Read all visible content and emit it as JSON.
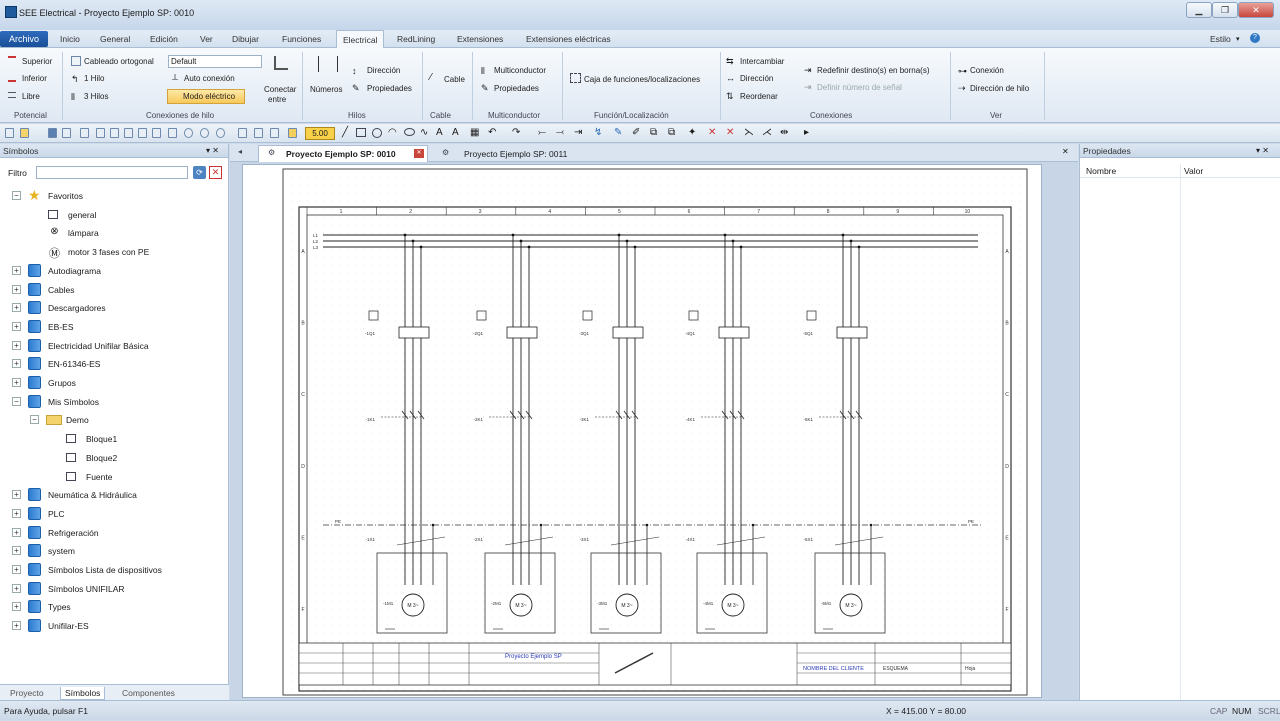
{
  "window": {
    "title": "SEE Electrical - Proyecto Ejemplo SP: 0010"
  },
  "menu": {
    "tabs": [
      "Archivo",
      "Inicio",
      "General",
      "Edición",
      "Ver",
      "Dibujar",
      "Funciones",
      "Electrical",
      "RedLining",
      "Extensiones",
      "Extensiones eléctricas"
    ],
    "style_label": "Estilo"
  },
  "ribbon": {
    "potencial": {
      "superior": "Superior",
      "inferior": "Inferior",
      "libre": "Libre",
      "group": "Potencial"
    },
    "conexiones_hilo": {
      "cableado": "Cableado ortogonal",
      "default": "Default",
      "one": "1 Hilo",
      "auto": "Auto conexión",
      "three": "3 Hilos",
      "modo": "Modo eléctrico",
      "conectar": "Conectar",
      "entre": "entre",
      "group": "Conexiones de hilo"
    },
    "hilos": {
      "numeros": "Números",
      "direccion": "Dirección",
      "propiedades": "Propiedades",
      "group": "Hilos"
    },
    "cable": {
      "cable": "Cable",
      "group": "Cable"
    },
    "multiconductor": {
      "multi": "Multiconductor",
      "propiedades": "Propiedades",
      "group": "Multiconductor"
    },
    "funcion": {
      "caja": "Caja de funciones/localizaciones",
      "group": "Función/Localización"
    },
    "conexiones": {
      "intercambiar": "Intercambiar",
      "direccion": "Dirección",
      "reordenar": "Reordenar",
      "redefinir": "Redefinir destino(s) en borna(s)",
      "definir": "Definir número de señal",
      "group": "Conexiones"
    },
    "ver": {
      "conexion": "Conexión",
      "direccion_hilo": "Dirección de hilo",
      "group": "Ver"
    }
  },
  "toolbar": {
    "zoom_value": "5.00"
  },
  "left_panel": {
    "title": "Símbolos",
    "filter_label": "Filtro",
    "tree": [
      {
        "label": "Favoritos",
        "level": 0,
        "expanded": true,
        "icon": "star-icon"
      },
      {
        "label": "general",
        "level": 1,
        "icon": "symbol-icon"
      },
      {
        "label": "lámpara",
        "level": 1,
        "icon": "lamp-icon"
      },
      {
        "label": "motor 3 fases con PE",
        "level": 1,
        "icon": "motor-icon"
      },
      {
        "label": "Autodiagrama",
        "level": 0,
        "icon": "book-icon"
      },
      {
        "label": "Cables",
        "level": 0,
        "icon": "book-icon"
      },
      {
        "label": "Descargadores",
        "level": 0,
        "icon": "book-icon"
      },
      {
        "label": "EB-ES",
        "level": 0,
        "icon": "book-icon"
      },
      {
        "label": "Electricidad Unifilar Básica",
        "level": 0,
        "icon": "book-icon"
      },
      {
        "label": "EN-61346-ES",
        "level": 0,
        "icon": "book-icon"
      },
      {
        "label": "Grupos",
        "level": 0,
        "icon": "book-icon"
      },
      {
        "label": "Mis Símbolos",
        "level": 0,
        "expanded": true,
        "icon": "book-icon"
      },
      {
        "label": "Demo",
        "level": 1,
        "expanded": true,
        "icon": "folder-icon"
      },
      {
        "label": "Bloque1",
        "level": 2,
        "icon": "symbol-icon"
      },
      {
        "label": "Bloque2",
        "level": 2,
        "icon": "symbol-icon"
      },
      {
        "label": "Fuente",
        "level": 2,
        "icon": "symbol-icon"
      },
      {
        "label": "Neumática & Hidráulica",
        "level": 0,
        "icon": "book-icon"
      },
      {
        "label": "PLC",
        "level": 0,
        "icon": "book-icon"
      },
      {
        "label": "Refrigeración",
        "level": 0,
        "icon": "book-icon"
      },
      {
        "label": "system",
        "level": 0,
        "icon": "book-icon"
      },
      {
        "label": "Símbolos Lista de dispositivos",
        "level": 0,
        "icon": "book-icon"
      },
      {
        "label": "Símbolos UNIFILAR",
        "level": 0,
        "icon": "book-icon"
      },
      {
        "label": "Types",
        "level": 0,
        "icon": "book-icon"
      },
      {
        "label": "Unifilar-ES",
        "level": 0,
        "icon": "book-icon"
      }
    ],
    "bottom_tabs": [
      "Proyecto",
      "Símbolos",
      "Componentes"
    ]
  },
  "document": {
    "tabs": [
      "Proyecto Ejemplo SP: 0010",
      "Proyecto Ejemplo SP: 0011"
    ]
  },
  "drawing": {
    "column_markers": [
      "1",
      "2",
      "3",
      "4",
      "5",
      "6",
      "7",
      "8",
      "9",
      "10"
    ],
    "row_markers": [
      "A",
      "B",
      "C",
      "D",
      "E",
      "F"
    ],
    "bus_labels": [
      "L1",
      "L2",
      "L3"
    ],
    "pe_label": "PE",
    "circuits": [
      {
        "q1": "-1Q1",
        "k1": "-1K1",
        "m": "-1M1",
        "x": "-1X1"
      },
      {
        "q1": "-2Q1",
        "k1": "-2K1",
        "m": "-2M1",
        "x": "-2X1"
      },
      {
        "q1": "-3Q1",
        "k1": "-3K1",
        "m": "-3M1",
        "x": "-3X1"
      },
      {
        "q1": "-4Q1",
        "k1": "-4K1",
        "m": "-4M1",
        "x": "-4X1"
      },
      {
        "q1": "-5Q1",
        "k1": "-5K1",
        "m": "-5M1",
        "x": "-5X1"
      }
    ],
    "motor_label": "M 3~",
    "title_block": {
      "project": "Proyecto Ejemplo SP",
      "client": "NOMBRE DEL CLIENTE",
      "drawing": "ESQUEMA",
      "sheet": "Hoja"
    }
  },
  "right_panel": {
    "title": "Propiedades",
    "col_name": "Nombre",
    "col_value": "Valor"
  },
  "status": {
    "help": "Para Ayuda, pulsar F1",
    "coords": "X = 415.00  Y = 80.00",
    "caps": "CAP",
    "num": "NUM",
    "scrl": "SCRL"
  }
}
